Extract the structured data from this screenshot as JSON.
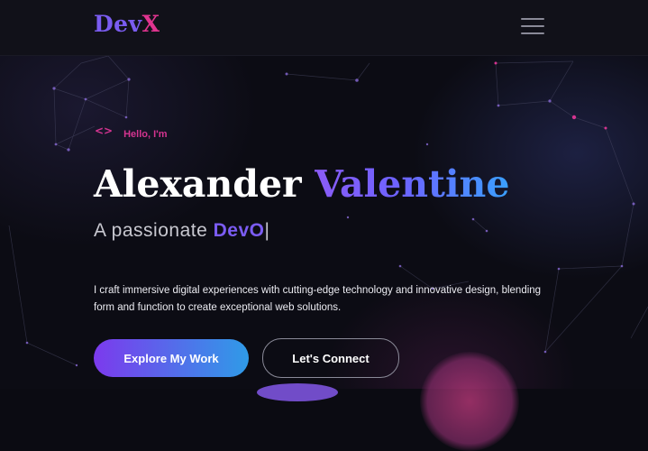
{
  "navbar": {
    "logo_part1": "Dev",
    "logo_part2": "X",
    "menu_icon": "hamburger-menu-icon"
  },
  "hero": {
    "code_icon": "code-brackets-icon",
    "code_glyph": "<>",
    "greeting": "Hello, I'm",
    "first_name": "Alexander",
    "last_name": "Valentine",
    "tagline_prefix": "A passionate",
    "role_typed": "DevO",
    "cursor": "|",
    "description": "I craft immersive digital experiences with cutting-edge technology and innovative design, blending form and function to create exceptional web solutions.",
    "primary_button": "Explore My Work",
    "secondary_button": "Let's Connect"
  },
  "colors": {
    "accent_purple": "#7b5cf2",
    "accent_pink": "#d43490",
    "accent_blue": "#3aa0ff",
    "background": "#0c0c14"
  }
}
